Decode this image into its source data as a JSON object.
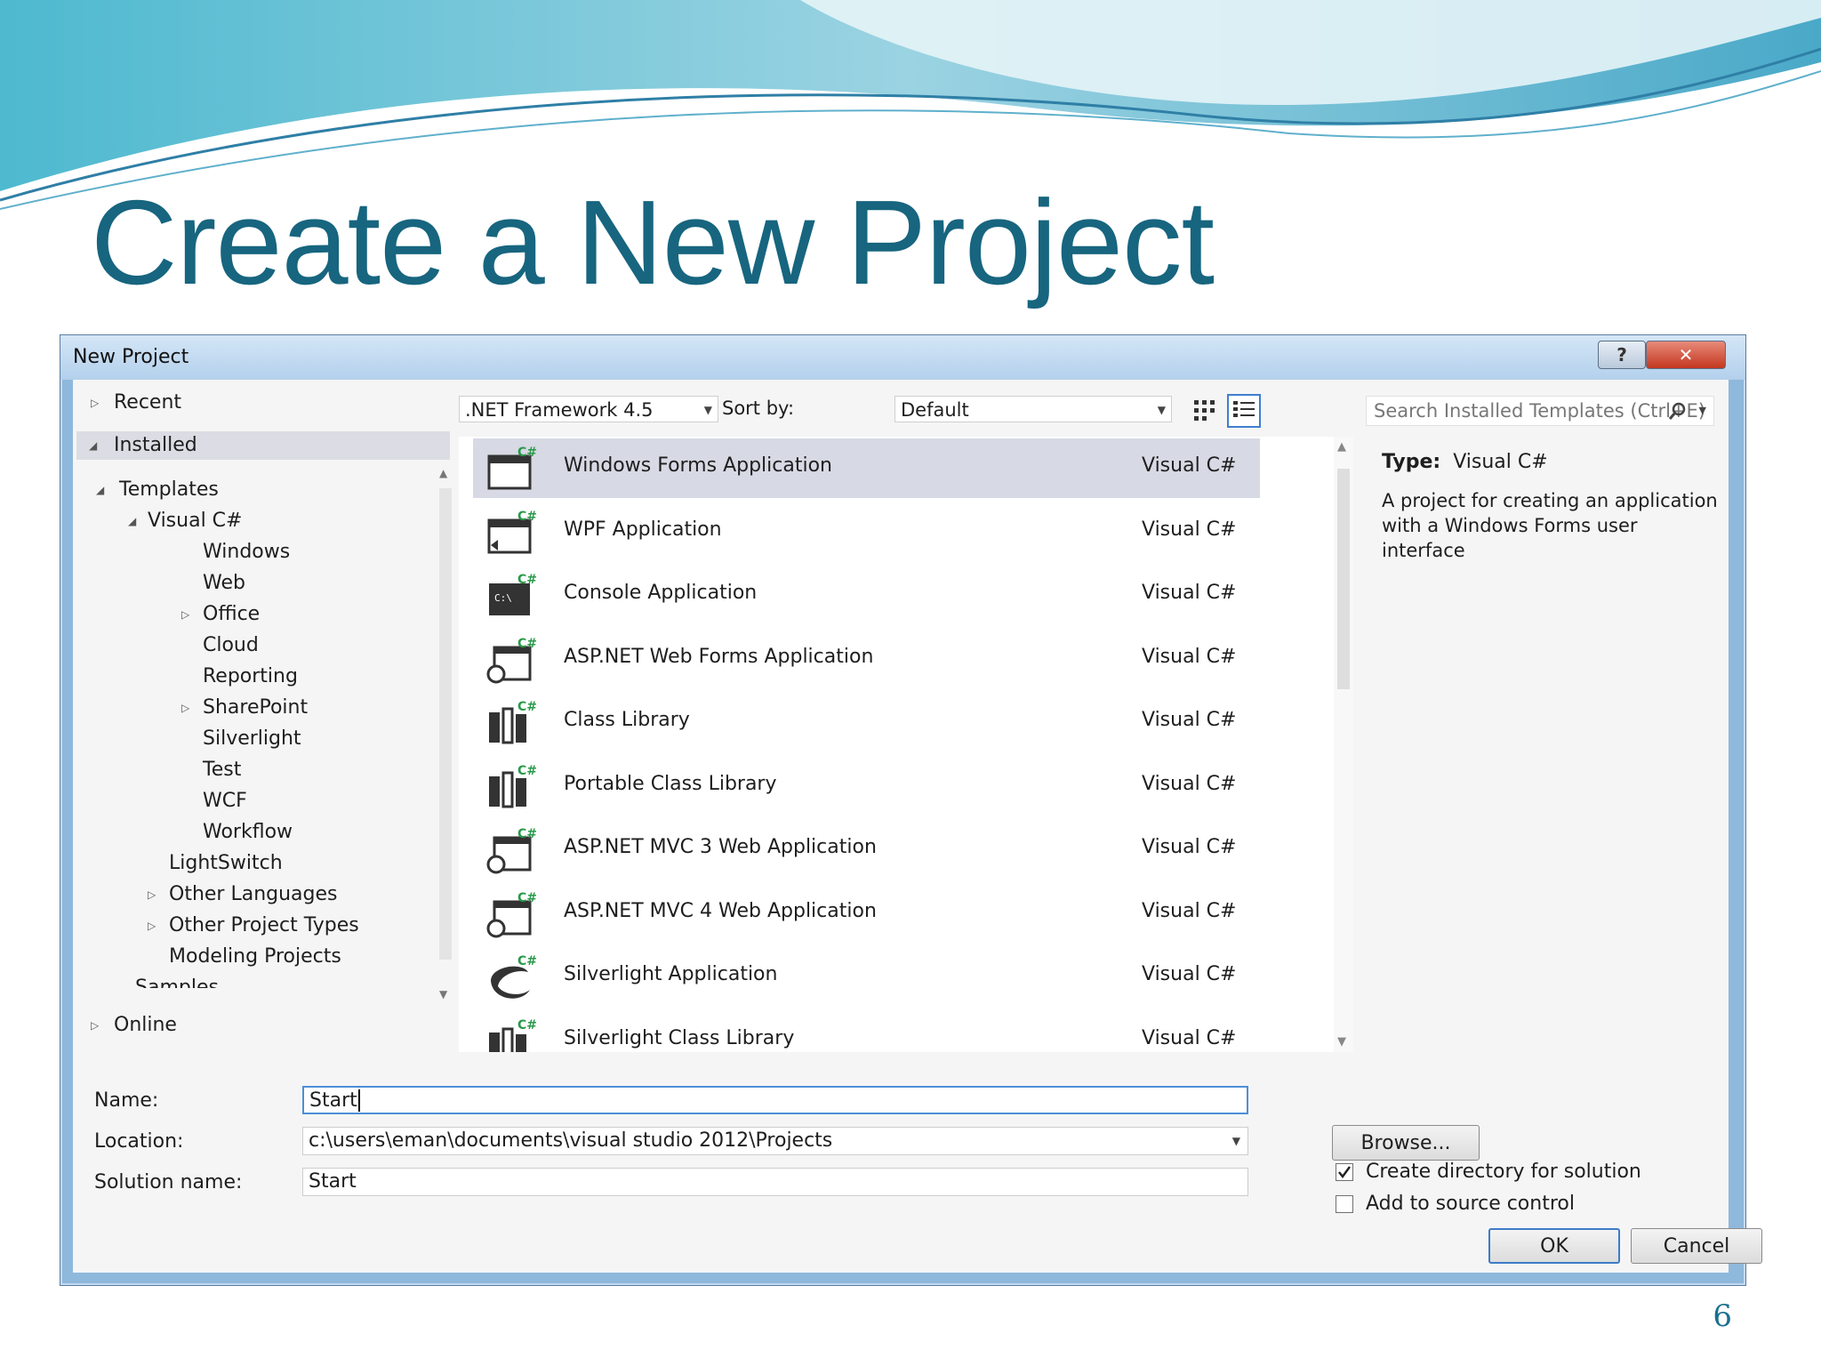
{
  "slide": {
    "title": "Create a New Project",
    "page_number": "6",
    "colors": {
      "title": "#17657f",
      "wave_dark": "#3aa9c4",
      "wave_light": "#a9dce8"
    }
  },
  "dialog": {
    "title": "New Project",
    "help_label": "?",
    "close_label": "✕",
    "tree": {
      "recent": "Recent",
      "installed": "Installed",
      "templates": "Templates",
      "visual_cs": "Visual C#",
      "items": [
        "Windows",
        "Web",
        "Office",
        "Cloud",
        "Reporting",
        "SharePoint",
        "Silverlight",
        "Test",
        "WCF",
        "Workflow"
      ],
      "lightswitch": "LightSwitch",
      "other_languages": "Other Languages",
      "other_project_types": "Other Project Types",
      "modeling_projects": "Modeling Projects",
      "samples": "Samples",
      "online": "Online"
    },
    "toolbar": {
      "framework": ".NET Framework 4.5",
      "sort_by_label": "Sort by:",
      "sort_value": "Default",
      "search_placeholder": "Search Installed Templates (Ctrl+E)"
    },
    "templates": [
      {
        "name": "Windows Forms Application",
        "lang": "Visual C#",
        "icon": "windows-forms-icon"
      },
      {
        "name": "WPF Application",
        "lang": "Visual C#",
        "icon": "wpf-icon"
      },
      {
        "name": "Console Application",
        "lang": "Visual C#",
        "icon": "console-icon"
      },
      {
        "name": "ASP.NET Web Forms Application",
        "lang": "Visual C#",
        "icon": "web-forms-icon"
      },
      {
        "name": "Class Library",
        "lang": "Visual C#",
        "icon": "class-library-icon"
      },
      {
        "name": "Portable Class Library",
        "lang": "Visual C#",
        "icon": "portable-class-library-icon"
      },
      {
        "name": "ASP.NET MVC 3 Web Application",
        "lang": "Visual C#",
        "icon": "mvc3-icon"
      },
      {
        "name": "ASP.NET MVC 4 Web Application",
        "lang": "Visual C#",
        "icon": "mvc4-icon"
      },
      {
        "name": "Silverlight Application",
        "lang": "Visual C#",
        "icon": "silverlight-icon"
      },
      {
        "name": "Silverlight Class Library",
        "lang": "Visual C#",
        "icon": "silverlight-class-library-icon"
      }
    ],
    "info": {
      "type_label": "Type:",
      "type_value": "Visual C#",
      "description": "A project for creating an application with a Windows Forms user interface"
    },
    "form": {
      "name_label": "Name:",
      "name_value": "Start",
      "location_label": "Location:",
      "location_value": "c:\\users\\eman\\documents\\visual studio 2012\\Projects",
      "solution_label": "Solution name:",
      "solution_value": "Start",
      "browse_label": "Browse...",
      "create_dir_label": "Create directory for solution",
      "create_dir_checked": true,
      "source_control_label": "Add to source control",
      "source_control_checked": false,
      "ok_label": "OK",
      "cancel_label": "Cancel"
    }
  }
}
